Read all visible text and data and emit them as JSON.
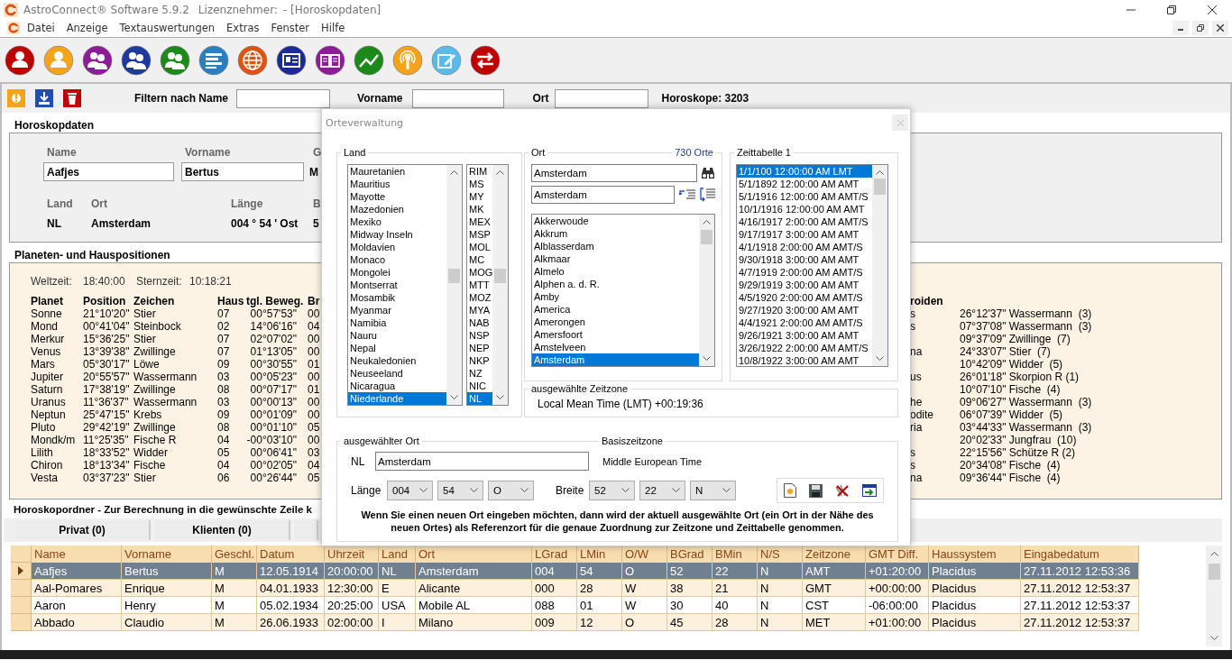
{
  "window": {
    "title": "AstroConnect® Software 5.9.2",
    "licensee_label": "Lizenznehmer:",
    "document": "- [Horoskopdaten]"
  },
  "menu": [
    "Datei",
    "Anzeige",
    "Textauswertungen",
    "Extras",
    "Fenster",
    "Hilfe"
  ],
  "filter": {
    "name_label": "Filtern nach Name",
    "vorname_label": "Vorname",
    "ort_label": "Ort",
    "count": "Horoskope: 3203"
  },
  "horoskopdaten": {
    "title": "Horoskopdaten",
    "name_label": "Name",
    "vorname_label": "Vorname",
    "geschl_label": "G",
    "name": "Aafjes",
    "vorname": "Bertus",
    "geschl": "M",
    "land_label": "Land",
    "ort_label": "Ort",
    "laenge_label": "Länge",
    "breite_label": "B",
    "land": "NL",
    "ort": "Amsterdam",
    "laenge": "004 ° 54 ' Ost",
    "breite": "5"
  },
  "planeten": {
    "title": "Planeten- und Hauspositionen",
    "weltzeit_label": "Weltzeit:",
    "weltzeit": "18:40:00",
    "sternzeit_label": "Sternzeit:",
    "sternzeit": "10:18:21",
    "columns": [
      "Planet",
      "Position",
      "Zeichen",
      "Haus",
      "tgl. Beweg.",
      "Br"
    ],
    "rows": [
      [
        "Sonne",
        "21°10'20\"",
        "Stier",
        "07",
        "00°57'53\"",
        "00"
      ],
      [
        "Mond",
        "00°41'04\"",
        "Steinbock",
        "02",
        "14°06'16\"",
        "04"
      ],
      [
        "Merkur",
        "15°36'25\"",
        "Stier",
        "07",
        "02°07'02\"",
        "00"
      ],
      [
        "Venus",
        "13°39'38\"",
        "Zwillinge",
        "07",
        "01°13'05\"",
        "00"
      ],
      [
        "Mars",
        "05°30'17\"",
        "Löwe",
        "09",
        "00°30'55\"",
        "01"
      ],
      [
        "Jupiter",
        "20°55'57\"",
        "Wassermann",
        "03",
        "00°05'23\"",
        "00"
      ],
      [
        "Saturn",
        "17°38'19\"",
        "Zwillinge",
        "08",
        "00°07'17\"",
        "01"
      ],
      [
        "Uranus",
        "11°36'37\"",
        "Wassermann",
        "03",
        "00°00'13\"",
        "00"
      ],
      [
        "Neptun",
        "25°47'15\"",
        "Krebs",
        "09",
        "00°01'09\"",
        "00"
      ],
      [
        "Pluto",
        "29°42'19\"",
        "Zwillinge",
        "08",
        "00°01'10\"",
        "05"
      ],
      [
        "Mondk/m",
        "11°25'35\"",
        "Fische R",
        "04",
        "-00°03'10\"",
        "00"
      ],
      [
        "Lilith",
        "18°33'52\"",
        "Widder",
        "05",
        "00°06'41\"",
        "03"
      ],
      [
        "Chiron",
        "18°13'34\"",
        "Fische",
        "04",
        "00°02'05\"",
        "04"
      ],
      [
        "Vesta",
        "03°37'23\"",
        "Stier",
        "06",
        "00°26'44\"",
        "05"
      ]
    ],
    "asteroids_title": "roiden",
    "asteroids": [
      {
        "name": "s",
        "value": "26°12'37\" Wassermann  (3)"
      },
      {
        "name": "s",
        "value": "07°37'08\" Wassermann  (3)"
      },
      {
        "value": "09°37'09\" Zwillinge  (7)"
      },
      {
        "name": "na",
        "value": "24°33'07\" Stier  (7)"
      },
      {
        "value": "10°42'09\" Widder  (5)"
      },
      {
        "name": "us",
        "value": "26°01'18\" Skorpion R (1)"
      },
      {
        "value": "10°07'10\" Fische  (4)"
      },
      {
        "name": "he",
        "value": "09°06'27\" Wassermann  (3)"
      },
      {
        "name": "odite",
        "value": "06°07'39\" Widder  (5)"
      },
      {
        "name": "ria",
        "value": "03°44'33\" Wassermann  (3)"
      },
      {
        "value": "20°02'33\" Jungfrau  (10)"
      },
      {
        "name": "s",
        "value": "22°15'56\" Schütze R (2)"
      },
      {
        "name": "s",
        "value": "20°34'08\" Fische  (4)"
      },
      {
        "name": "na",
        "value": "09°36'44\" Fische  (4)"
      }
    ]
  },
  "ordner": {
    "title": "Horoskopordner - Zur Berechnung in die gewünschte Zeile k",
    "tabs": [
      {
        "label": "Privat (0)",
        "selected": false
      },
      {
        "label": "Klienten (0)",
        "selected": false
      }
    ],
    "columns": [
      "Name",
      "Vorname",
      "Geschl.",
      "Datum",
      "Uhrzeit",
      "Land",
      "Ort",
      "LGrad",
      "LMin",
      "O/W",
      "BGrad",
      "BMin",
      "N/S",
      "Zeitzone",
      "GMT Diff.",
      "Haussystem",
      "Eingabedatum"
    ],
    "rows": [
      {
        "selected": true,
        "cells": [
          "Aafjes",
          "Bertus",
          "M",
          "12.05.1914",
          "20:00:00",
          "NL",
          "Amsterdam",
          "004",
          "54",
          "O",
          "52",
          "22",
          "N",
          "AMT",
          "+01:20:00",
          "Placidus",
          "27.11.2012 12:53:36"
        ]
      },
      {
        "selected": false,
        "cells": [
          "Aal-Pomares",
          "Enrique",
          "M",
          "04.01.1933",
          "12:30:00",
          "E",
          "Alicante",
          "000",
          "28",
          "W",
          "38",
          "21",
          "N",
          "GMT",
          "+00:00:00",
          "Placidus",
          "27.11.2012 12:53:37"
        ]
      },
      {
        "selected": false,
        "cells": [
          "Aaron",
          "Henry",
          "M",
          "05.02.1934",
          "20:25:00",
          "USA",
          "Mobile AL",
          "088",
          "01",
          "W",
          "30",
          "40",
          "N",
          "CST",
          "-06:00:00",
          "Placidus",
          "27.11.2012 12:53:37"
        ]
      },
      {
        "selected": false,
        "cells": [
          "Abbado",
          "Claudio",
          "M",
          "26.06.1933",
          "02:00:00",
          "I",
          "Milano",
          "009",
          "12",
          "O",
          "45",
          "28",
          "N",
          "MET",
          "+01:00:00",
          "Placidus",
          "27.11.2012 12:53:37"
        ]
      }
    ]
  },
  "dialog": {
    "title": "Orteverwaltung",
    "land": {
      "title": "Land",
      "countries": [
        {
          "name": "Mauretanien",
          "code": "RIM",
          "selected": false
        },
        {
          "name": "Mauritius",
          "code": "MS",
          "selected": false
        },
        {
          "name": "Mayotte",
          "code": "MY",
          "selected": false
        },
        {
          "name": "Mazedonien",
          "code": "MK",
          "selected": false
        },
        {
          "name": "Mexiko",
          "code": "MEX",
          "selected": false
        },
        {
          "name": "Midway Inseln",
          "code": "MSP",
          "selected": false
        },
        {
          "name": "Moldavien",
          "code": "MOL",
          "selected": false
        },
        {
          "name": "Monaco",
          "code": "MC",
          "selected": false
        },
        {
          "name": "Mongolei",
          "code": "MOG",
          "selected": false
        },
        {
          "name": "Montserrat",
          "code": "MTT",
          "selected": false
        },
        {
          "name": "Mosambik",
          "code": "MOZ",
          "selected": false
        },
        {
          "name": "Myanmar",
          "code": "MYA",
          "selected": false
        },
        {
          "name": "Namibia",
          "code": "NAB",
          "selected": false
        },
        {
          "name": "Nauru",
          "code": "NSP",
          "selected": false
        },
        {
          "name": "Nepal",
          "code": "NEP",
          "selected": false
        },
        {
          "name": "Neukaledonien",
          "code": "NKP",
          "selected": false
        },
        {
          "name": "Neuseeland",
          "code": "NZ",
          "selected": false
        },
        {
          "name": "Nicaragua",
          "code": "NIC",
          "selected": false
        },
        {
          "name": "Niederlande",
          "code": "NL",
          "selected": true
        }
      ]
    },
    "ort": {
      "title": "Ort",
      "count": "730 Orte",
      "search": "Amsterdam",
      "filter": "Amsterdam",
      "places": [
        {
          "name": "Akkerwoude",
          "selected": false
        },
        {
          "name": "Akkrum",
          "selected": false
        },
        {
          "name": "Alblasserdam",
          "selected": false
        },
        {
          "name": "Alkmaar",
          "selected": false
        },
        {
          "name": "Almelo",
          "selected": false
        },
        {
          "name": "Alphen a. d. R.",
          "selected": false
        },
        {
          "name": "Amby",
          "selected": false
        },
        {
          "name": "America",
          "selected": false
        },
        {
          "name": "Amerongen",
          "selected": false
        },
        {
          "name": "Amersfoort",
          "selected": false
        },
        {
          "name": "Amstelveen",
          "selected": false
        },
        {
          "name": "Amsterdam",
          "selected": true
        }
      ]
    },
    "zeittabelle": {
      "title": "Zeittabelle 1",
      "entries": [
        {
          "text": "1/1/100 12:00:00 AM LMT",
          "selected": true
        },
        {
          "text": "5/1/1892 12:00:00 AM AMT",
          "selected": false
        },
        {
          "text": "5/1/1916 12:00:00 AM AMT/S",
          "selected": false
        },
        {
          "text": "10/1/1916 12:00:00 AM AMT",
          "selected": false
        },
        {
          "text": "4/16/1917 2:00:00 AM AMT/S",
          "selected": false
        },
        {
          "text": "9/17/1917 3:00:00 AM AMT",
          "selected": false
        },
        {
          "text": "4/1/1918 2:00:00 AM AMT/S",
          "selected": false
        },
        {
          "text": "9/30/1918 3:00:00 AM AMT",
          "selected": false
        },
        {
          "text": "4/7/1919 2:00:00 AM AMT/S",
          "selected": false
        },
        {
          "text": "9/29/1919 3:00:00 AM AMT",
          "selected": false
        },
        {
          "text": "4/5/1920 2:00:00 AM AMT/S",
          "selected": false
        },
        {
          "text": "9/27/1920 3:00:00 AM AMT",
          "selected": false
        },
        {
          "text": "4/4/1921 2:00:00 AM AMT/S",
          "selected": false
        },
        {
          "text": "9/26/1921 3:00:00 AM AMT",
          "selected": false
        },
        {
          "text": "3/26/1922 2:00:00 AM AMT/S",
          "selected": false
        },
        {
          "text": "10/8/1922 3:00:00 AM AMT",
          "selected": false
        }
      ]
    },
    "zeitzone": {
      "title": "ausgewählte Zeitzone",
      "value": "Local Mean Time (LMT) +00:19:36"
    },
    "selected_place": {
      "title": "ausgewählter Ort",
      "land": "NL",
      "name": "Amsterdam",
      "basis_label": "Basiszeitzone",
      "basis": "Middle European Time",
      "laenge_label": "Länge",
      "laenge": [
        "004",
        "54",
        "O"
      ],
      "breite_label": "Breite",
      "breite": [
        "52",
        "22",
        "N"
      ],
      "hint": "Wenn Sie einen neuen Ort eingeben möchten, dann wird der aktuell ausgewählte Ort (ein Ort in der Nähe des neuen Ortes) als Referenzort für die genaue Zuordnung zur Zeitzone und Zeittabelle genommen."
    }
  }
}
